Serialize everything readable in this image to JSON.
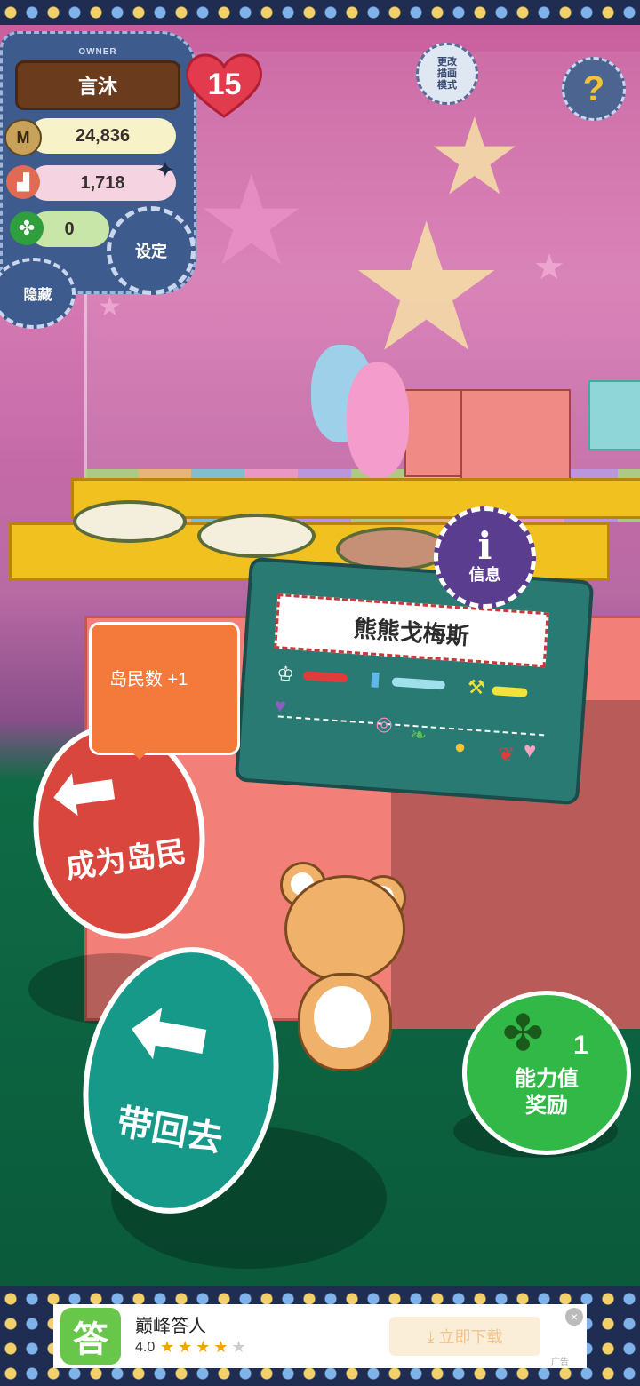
{
  "hud": {
    "owner_label": "OWNER",
    "player_name": "言沐",
    "level": "15",
    "coins": "24,836",
    "materials": "1,718",
    "clovers": "0",
    "settings_label": "设定",
    "hide_label": "隐藏",
    "mode_label": "更改\n描画\n模式",
    "help_label": "?"
  },
  "character": {
    "name": "熊熊戈梅斯",
    "info_label": "信息"
  },
  "actions": {
    "bubble_text": "岛民数 +1",
    "become_islander": "成为岛民",
    "take_back": "带回去",
    "reward_count": "1",
    "reward_label": "能力值\n奖励"
  },
  "ad": {
    "icon_text": "答",
    "title": "巅峰答人",
    "rating": "4.0",
    "stars_on": "★★★★",
    "stars_off": "★",
    "download_label": "⤓ 立即下载",
    "close": "×",
    "ad_mark": "广告"
  },
  "colors": {
    "hud_panel": "#3e5b8e",
    "wall_pink": "#c9609e",
    "floor_green": "#0a5a3b",
    "become_btn": "#d9463d",
    "takeback_btn": "#17998a",
    "reward_btn": "#31b846"
  },
  "icons": [
    "coin-icon",
    "basket-icon",
    "clover-icon",
    "heart-icon",
    "gear-icon",
    "question-icon",
    "info-icon",
    "arrow-left-icon"
  ]
}
